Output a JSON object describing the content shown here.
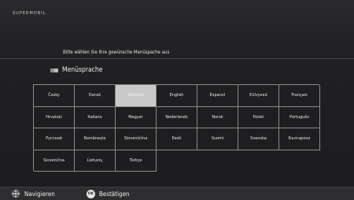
{
  "header": {
    "logo_text": "SUPERMOBIL"
  },
  "instruction": "Bitte wählen Sie Ihre gewünsche Menüspache aus",
  "section": {
    "title": "Menüsprache",
    "icon": "flag-icon"
  },
  "languages": [
    [
      "Česky",
      "Dansk",
      "Deutsch",
      "English",
      "Espanol",
      "Ελληνικά",
      "Français"
    ],
    [
      "Hrvatski",
      "Italiano",
      "Magyar",
      "Nederlands",
      "Norsk",
      "Polski",
      "Português"
    ],
    [
      "Русский",
      "Românește",
      "Slovenščina",
      "Eesti",
      "Suomi",
      "Svenska",
      "Български"
    ],
    [
      "Slovenčina",
      "Lietuvių",
      "Türkçe",
      "",
      "",
      "",
      ""
    ]
  ],
  "selected_language": "Deutsch",
  "footer": {
    "navigate_label": "Navigieren",
    "confirm_label": "Bestätigen",
    "ok_icon_text": "OK"
  },
  "colors": {
    "background": "#1c1c1e",
    "selected_cell": "#c9c9c9",
    "grid_line": "#8a8a8a",
    "footer_bar": "#2e2e30"
  }
}
